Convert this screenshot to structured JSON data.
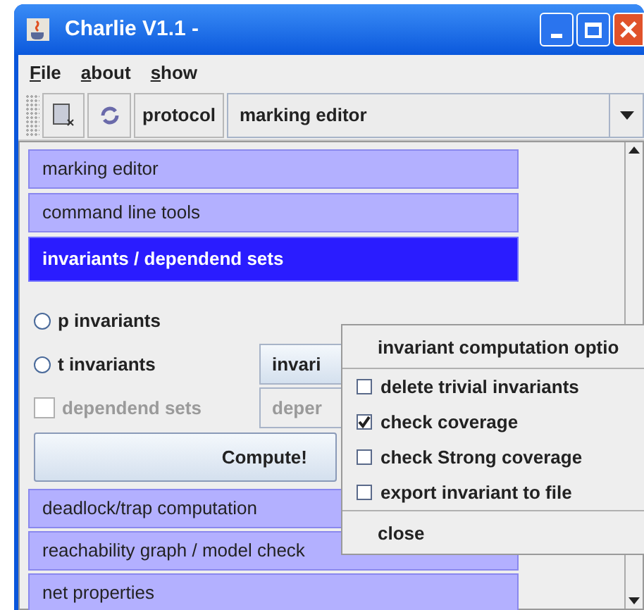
{
  "window": {
    "title": "Charlie V1.1 -"
  },
  "menu": [
    {
      "label": "File"
    },
    {
      "label": "about"
    },
    {
      "label": "show"
    }
  ],
  "toolbar": {
    "protocol_button": "protocol",
    "view_select": "marking editor"
  },
  "sections_top": [
    {
      "label": "marking editor",
      "selected": false
    },
    {
      "label": "command line tools",
      "selected": false
    },
    {
      "label": "invariants / dependend sets",
      "selected": true
    }
  ],
  "invariant_options": [
    {
      "kind": "radio",
      "label": "p invariants",
      "selected": false,
      "disabled": false
    },
    {
      "kind": "radio",
      "label": "t invariants",
      "selected": false,
      "disabled": false,
      "button": {
        "label": "invari",
        "disabled": false
      }
    },
    {
      "kind": "checkbox",
      "label": "dependend sets",
      "checked": false,
      "disabled": true,
      "button": {
        "label": "deper",
        "disabled": true
      }
    }
  ],
  "compute_button": "Compute!",
  "sections_bottom": [
    {
      "label": "deadlock/trap computation",
      "selected": false
    },
    {
      "label": "reachability graph / model check",
      "selected": false
    },
    {
      "label": "net properties",
      "selected": false
    }
  ],
  "popup": {
    "title": "invariant computation optio",
    "items": [
      {
        "kind": "check",
        "label": "delete trivial invariants",
        "checked": false
      },
      {
        "kind": "check",
        "label": "check coverage",
        "checked": true
      },
      {
        "kind": "check",
        "label": "check Strong coverage",
        "checked": false
      },
      {
        "kind": "check",
        "label": "export invariant to file",
        "checked": false
      },
      {
        "kind": "action",
        "label": "close"
      }
    ]
  }
}
